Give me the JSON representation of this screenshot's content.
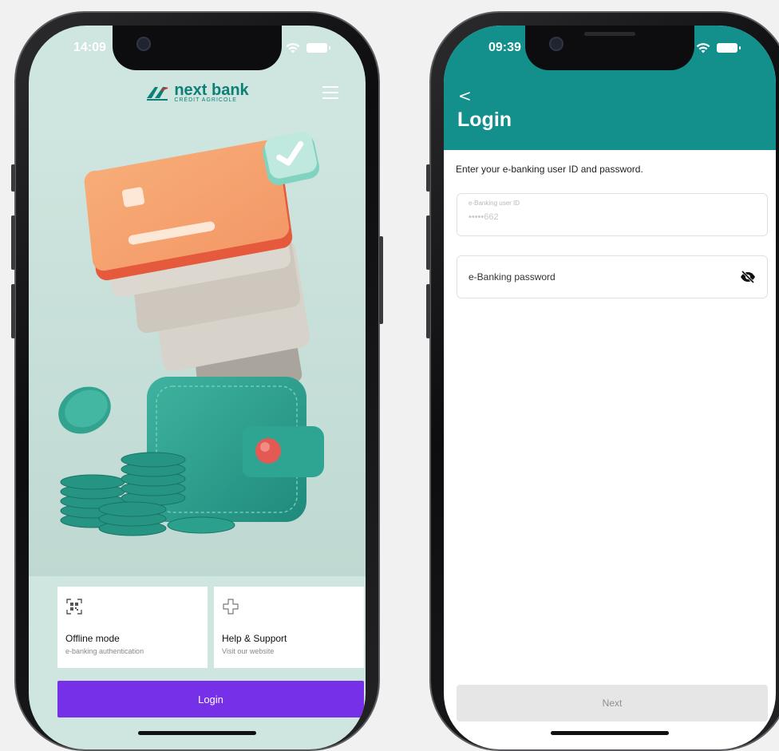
{
  "left_phone": {
    "status": {
      "time": "14:09"
    },
    "brand": {
      "name": "next bank",
      "subtitle": "CRÉDIT AGRICOLE",
      "color": "#0d7f76"
    },
    "tiles": [
      {
        "title": "Offline mode",
        "subtitle": "e-banking authentication",
        "icon": "qr-code-icon"
      },
      {
        "title": "Help & Support",
        "subtitle": "Visit our website",
        "icon": "medical-cross-icon"
      }
    ],
    "login_label": "Login",
    "colors": {
      "background": "#cfe5df",
      "login_button": "#7530e8"
    }
  },
  "right_phone": {
    "status": {
      "time": "09:39"
    },
    "header": {
      "back": "<",
      "title": "Login",
      "color": "#138f8c"
    },
    "instructions": "Enter your e-banking user ID and password.",
    "userid_field": {
      "label": "e-Banking user ID",
      "value": "•••••662"
    },
    "password_field": {
      "placeholder": "e-Banking password",
      "icon": "eye-slash-icon"
    },
    "next_label": "Next"
  }
}
